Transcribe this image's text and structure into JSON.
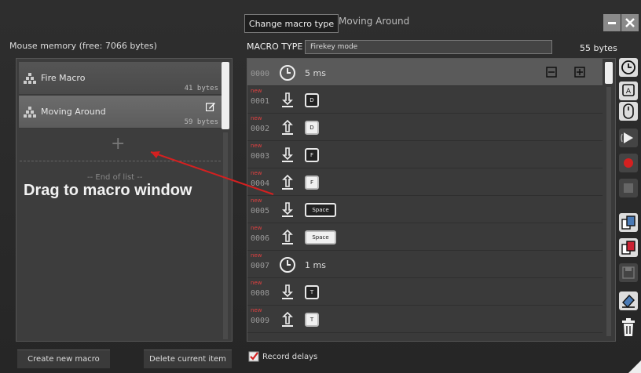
{
  "window": {
    "change_type_button": "Change macro type",
    "title": "Moving Around"
  },
  "left_panel": {
    "header": "Mouse memory (free: 7066 bytes)",
    "macros": [
      {
        "name": "Fire Macro",
        "bytes": "41 bytes"
      },
      {
        "name": "Moving Around",
        "bytes": "59 bytes"
      }
    ],
    "add_symbol": "+",
    "end_of_list": "-- End of list --",
    "annotation": "Drag to macro window",
    "create_button": "Create new macro",
    "delete_button": "Delete current item"
  },
  "right_panel": {
    "macro_type_label": "MACRO TYPE",
    "macro_type_value": "Firekey mode",
    "bytes": "55 bytes",
    "record_delays_label": "Record delays",
    "record_delays_checked": true,
    "steps": [
      {
        "num": "0000",
        "new": "",
        "type": "delay",
        "value": "5 ms"
      },
      {
        "num": "0001",
        "new": "new",
        "type": "key-down",
        "value": "D"
      },
      {
        "num": "0002",
        "new": "new",
        "type": "key-up",
        "value": "D"
      },
      {
        "num": "0003",
        "new": "new",
        "type": "key-down",
        "value": "F"
      },
      {
        "num": "0004",
        "new": "new",
        "type": "key-up",
        "value": "F"
      },
      {
        "num": "0005",
        "new": "new",
        "type": "key-down",
        "value": "Space"
      },
      {
        "num": "0006",
        "new": "new",
        "type": "key-up",
        "value": "Space"
      },
      {
        "num": "0007",
        "new": "new",
        "type": "delay",
        "value": "1 ms"
      },
      {
        "num": "0008",
        "new": "new",
        "type": "key-down",
        "value": "T"
      },
      {
        "num": "0009",
        "new": "new",
        "type": "key-up",
        "value": "T"
      }
    ]
  },
  "toolbar_icons": [
    "clock-icon",
    "keyboard-icon",
    "mouse-icon",
    "cursor-icon",
    "record-icon",
    "stop-icon",
    "copy-icon",
    "paste-icon",
    "save-icon",
    "erase-icon",
    "trash-icon"
  ],
  "colors": {
    "record": "#d42020",
    "annotation_arrow": "#d42020",
    "new_tag": "#e04040"
  }
}
